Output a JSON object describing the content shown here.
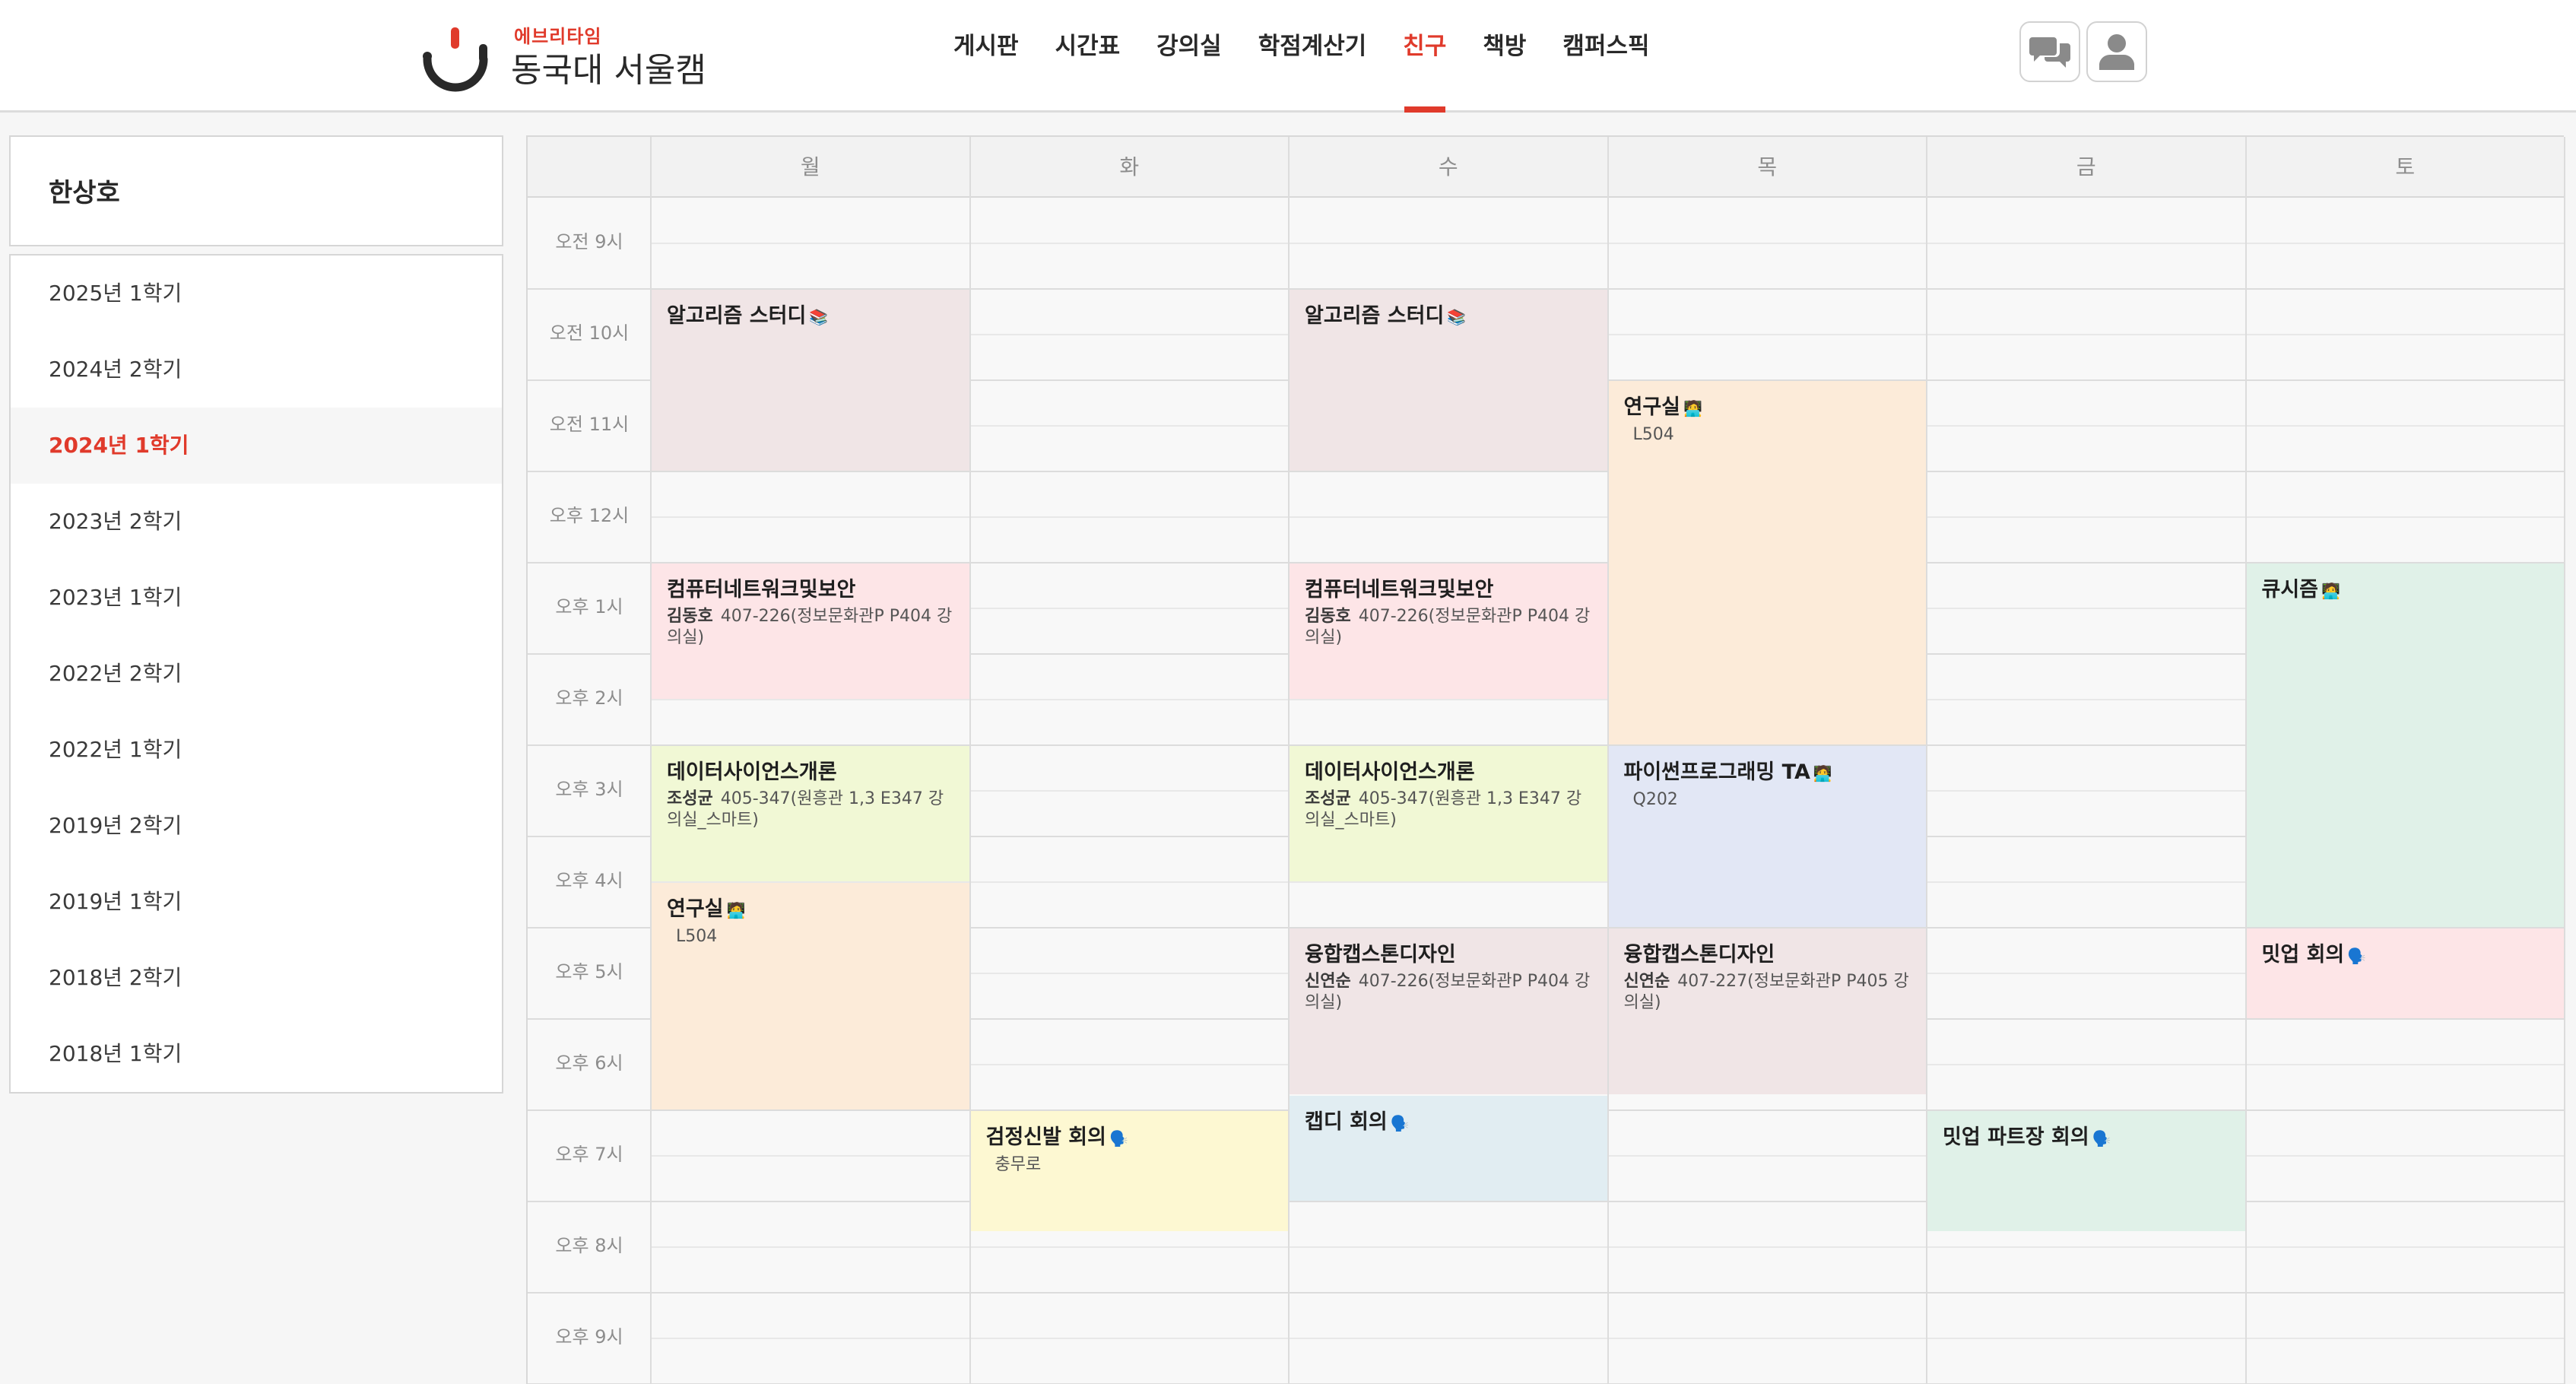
{
  "header": {
    "logo_small": "에브리타임",
    "logo_big": "동국대 서울캠",
    "nav": [
      "게시판",
      "시간표",
      "강의실",
      "학점계산기",
      "친구",
      "책방",
      "캠퍼스픽"
    ],
    "active_nav": 4,
    "colors": {
      "accent": "#e03a2b",
      "text": "#292929"
    },
    "icons": {
      "message": "chat-bubbles-icon",
      "profile": "person-icon"
    }
  },
  "sidebar": {
    "friend_name": "한상호",
    "semesters": [
      "2025년 1학기",
      "2024년 2학기",
      "2024년 1학기",
      "2023년 2학기",
      "2023년 1학기",
      "2022년 2학기",
      "2022년 1학기",
      "2019년 2학기",
      "2019년 1학기",
      "2018년 2학기",
      "2018년 1학기"
    ],
    "active_semester": 2
  },
  "timetable": {
    "days": [
      "월",
      "화",
      "수",
      "목",
      "금",
      "토"
    ],
    "times": [
      "오전 9시",
      "오전 10시",
      "오전 11시",
      "오후 12시",
      "오후 1시",
      "오후 2시",
      "오후 3시",
      "오후 4시",
      "오후 5시",
      "오후 6시",
      "오후 7시",
      "오후 8시",
      "오후 9시"
    ],
    "events": [
      {
        "day": 0,
        "start": 10,
        "end": 12,
        "title": "알고리즘 스터디",
        "icon": "📚",
        "color": "#f0e5e6"
      },
      {
        "day": 2,
        "start": 10,
        "end": 12,
        "title": "알고리즘 스터디",
        "icon": "📚",
        "color": "#f0e5e6"
      },
      {
        "day": 3,
        "start": 11,
        "end": 15,
        "title": "연구실",
        "icon": "🧑‍💻",
        "place": "L504",
        "color": "#fcebd9"
      },
      {
        "day": 0,
        "start": 13,
        "end": 14.5,
        "title": "컴퓨터네트워크및보안",
        "prof": "김동호",
        "place": "407-226(정보문화관P P404 강의실)",
        "color": "#fde5e7"
      },
      {
        "day": 2,
        "start": 13,
        "end": 14.5,
        "title": "컴퓨터네트워크및보안",
        "prof": "김동호",
        "place": "407-226(정보문화관P P404 강의실)",
        "color": "#fde5e7"
      },
      {
        "day": 5,
        "start": 13,
        "end": 17,
        "title": "큐시즘",
        "icon": "🧑‍💻",
        "color": "#e0f1e8"
      },
      {
        "day": 0,
        "start": 15,
        "end": 16.5,
        "title": "데이터사이언스개론",
        "prof": "조성균",
        "place": "405-347(원흥관 1,3 E347 강의실_스마트)",
        "color": "#f1f8d5"
      },
      {
        "day": 2,
        "start": 15,
        "end": 16.5,
        "title": "데이터사이언스개론",
        "prof": "조성균",
        "place": "405-347(원흥관 1,3 E347 강의실_스마트)",
        "color": "#f1f8d5"
      },
      {
        "day": 3,
        "start": 15,
        "end": 17,
        "title": "파이썬프로그래밍 TA",
        "icon": "🧑‍💻",
        "place": "Q202",
        "color": "#e2e7f5"
      },
      {
        "day": 0,
        "start": 16.5,
        "end": 19,
        "title": "연구실",
        "icon": "🧑‍💻",
        "place": "L504",
        "color": "#fcebd9"
      },
      {
        "day": 2,
        "start": 17,
        "end": 18.83,
        "title": "융합캡스톤디자인",
        "prof": "신연순",
        "place": "407-226(정보문화관P P404 강의실)",
        "color": "#f0e5e6"
      },
      {
        "day": 3,
        "start": 17,
        "end": 18.83,
        "title": "융합캡스톤디자인",
        "prof": "신연순",
        "place": "407-227(정보문화관P P405 강의실)",
        "color": "#f0e5e6"
      },
      {
        "day": 5,
        "start": 17,
        "end": 18,
        "title": "밋업 회의",
        "icon": "🗣️",
        "color": "#fde5e7"
      },
      {
        "day": 2,
        "start": 18.83,
        "end": 20,
        "title": "캡디 회의",
        "icon": "🗣️",
        "color": "#e1edf2"
      },
      {
        "day": 1,
        "start": 19,
        "end": 20.33,
        "title": "검정신발 회의",
        "icon": "🗣️",
        "place": "충무로",
        "color": "#fdf8d2"
      },
      {
        "day": 4,
        "start": 19,
        "end": 20.33,
        "title": "밋업 파트장 회의",
        "icon": "🗣️",
        "color": "#e0f1e8"
      }
    ]
  }
}
